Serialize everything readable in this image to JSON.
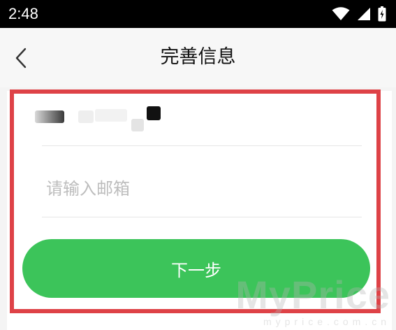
{
  "status_bar": {
    "time": "2:48",
    "icons": [
      "wifi-icon",
      "cellular-signal-icon",
      "battery-icon"
    ]
  },
  "nav": {
    "back_icon": "chevron-left-icon",
    "title": "完善信息"
  },
  "form": {
    "account_display": "obscured",
    "email_field": {
      "value": "",
      "placeholder": "请输入邮箱"
    },
    "next_button_label": "下一步"
  },
  "colors": {
    "accent_green": "#3cc45a",
    "highlight_red": "#de4247",
    "status_bar_bg": "#000000"
  },
  "watermark": {
    "main": "MyPrice",
    "sub": "myprice.com.cn"
  }
}
